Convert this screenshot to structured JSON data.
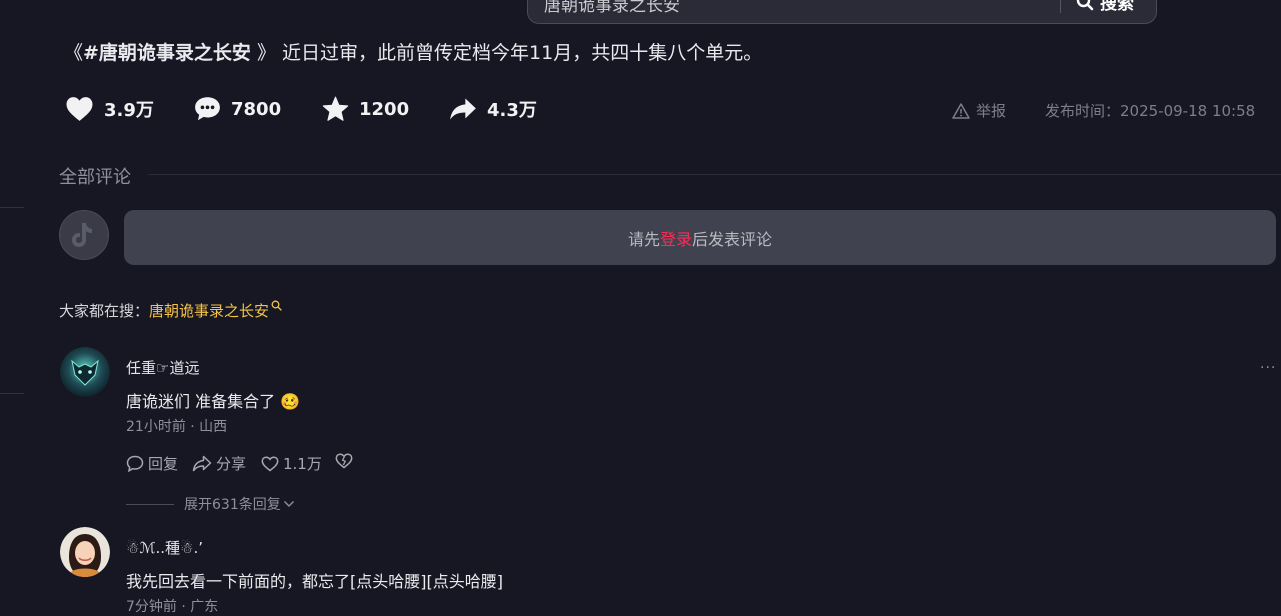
{
  "search": {
    "query": "唐朝诡事录之长安",
    "button_label": "搜索"
  },
  "video": {
    "title_open": "《",
    "title_tag": "#唐朝诡事录之长安",
    "title_close": " 》",
    "title_rest": " 近日过审，此前曾传定档今年11月，共四十集八个单元。",
    "likes": "3.9万",
    "comments": "7800",
    "favorites": "1200",
    "shares": "4.3万",
    "report_label": "举报",
    "publish_time": "发布时间：2025-09-18 10:58"
  },
  "comments_section": {
    "header": "全部评论",
    "input_prefix": "请先",
    "input_login": "登录",
    "input_suffix": "后发表评论",
    "trending_label": "大家都在搜：",
    "trending_keyword": "唐朝诡事录之长安"
  },
  "comments": [
    {
      "username": "任重☞道远",
      "text": "唐诡迷们  准备集合了 🥴",
      "meta": "21小时前 · 山西",
      "reply_label": "回复",
      "share_label": "分享",
      "likes": "1.1万",
      "expand_label": "展开631条回复"
    },
    {
      "username": "☃ℳ..種☃.՚",
      "text": "我先回去看一下前面的，都忘了[点头哈腰][点头哈腰]",
      "meta": "7分钟前 · 广东"
    }
  ],
  "colors": {
    "background": "#161722",
    "accent_login": "#fe2c55",
    "trending_keyword": "#f6c344"
  },
  "icons": [
    "search-icon",
    "heart-icon",
    "comment-icon",
    "star-icon",
    "share-icon",
    "warning-icon",
    "search-small-icon",
    "reply-icon",
    "share-arrow-icon",
    "like-icon",
    "dislike-icon",
    "chevron-down-icon",
    "more-icon"
  ]
}
